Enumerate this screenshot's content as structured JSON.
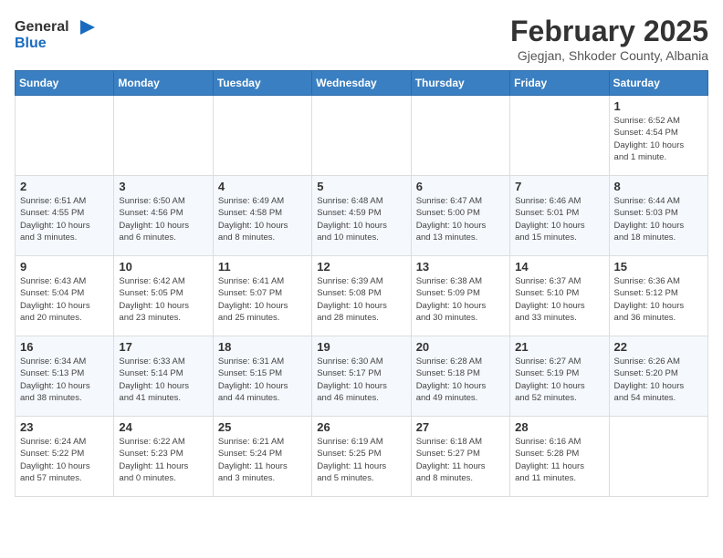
{
  "header": {
    "logo_general": "General",
    "logo_blue": "Blue",
    "title": "February 2025",
    "subtitle": "Gjegjan, Shkoder County, Albania"
  },
  "weekdays": [
    "Sunday",
    "Monday",
    "Tuesday",
    "Wednesday",
    "Thursday",
    "Friday",
    "Saturday"
  ],
  "weeks": [
    [
      {
        "day": "",
        "info": ""
      },
      {
        "day": "",
        "info": ""
      },
      {
        "day": "",
        "info": ""
      },
      {
        "day": "",
        "info": ""
      },
      {
        "day": "",
        "info": ""
      },
      {
        "day": "",
        "info": ""
      },
      {
        "day": "1",
        "info": "Sunrise: 6:52 AM\nSunset: 4:54 PM\nDaylight: 10 hours\nand 1 minute."
      }
    ],
    [
      {
        "day": "2",
        "info": "Sunrise: 6:51 AM\nSunset: 4:55 PM\nDaylight: 10 hours\nand 3 minutes."
      },
      {
        "day": "3",
        "info": "Sunrise: 6:50 AM\nSunset: 4:56 PM\nDaylight: 10 hours\nand 6 minutes."
      },
      {
        "day": "4",
        "info": "Sunrise: 6:49 AM\nSunset: 4:58 PM\nDaylight: 10 hours\nand 8 minutes."
      },
      {
        "day": "5",
        "info": "Sunrise: 6:48 AM\nSunset: 4:59 PM\nDaylight: 10 hours\nand 10 minutes."
      },
      {
        "day": "6",
        "info": "Sunrise: 6:47 AM\nSunset: 5:00 PM\nDaylight: 10 hours\nand 13 minutes."
      },
      {
        "day": "7",
        "info": "Sunrise: 6:46 AM\nSunset: 5:01 PM\nDaylight: 10 hours\nand 15 minutes."
      },
      {
        "day": "8",
        "info": "Sunrise: 6:44 AM\nSunset: 5:03 PM\nDaylight: 10 hours\nand 18 minutes."
      }
    ],
    [
      {
        "day": "9",
        "info": "Sunrise: 6:43 AM\nSunset: 5:04 PM\nDaylight: 10 hours\nand 20 minutes."
      },
      {
        "day": "10",
        "info": "Sunrise: 6:42 AM\nSunset: 5:05 PM\nDaylight: 10 hours\nand 23 minutes."
      },
      {
        "day": "11",
        "info": "Sunrise: 6:41 AM\nSunset: 5:07 PM\nDaylight: 10 hours\nand 25 minutes."
      },
      {
        "day": "12",
        "info": "Sunrise: 6:39 AM\nSunset: 5:08 PM\nDaylight: 10 hours\nand 28 minutes."
      },
      {
        "day": "13",
        "info": "Sunrise: 6:38 AM\nSunset: 5:09 PM\nDaylight: 10 hours\nand 30 minutes."
      },
      {
        "day": "14",
        "info": "Sunrise: 6:37 AM\nSunset: 5:10 PM\nDaylight: 10 hours\nand 33 minutes."
      },
      {
        "day": "15",
        "info": "Sunrise: 6:36 AM\nSunset: 5:12 PM\nDaylight: 10 hours\nand 36 minutes."
      }
    ],
    [
      {
        "day": "16",
        "info": "Sunrise: 6:34 AM\nSunset: 5:13 PM\nDaylight: 10 hours\nand 38 minutes."
      },
      {
        "day": "17",
        "info": "Sunrise: 6:33 AM\nSunset: 5:14 PM\nDaylight: 10 hours\nand 41 minutes."
      },
      {
        "day": "18",
        "info": "Sunrise: 6:31 AM\nSunset: 5:15 PM\nDaylight: 10 hours\nand 44 minutes."
      },
      {
        "day": "19",
        "info": "Sunrise: 6:30 AM\nSunset: 5:17 PM\nDaylight: 10 hours\nand 46 minutes."
      },
      {
        "day": "20",
        "info": "Sunrise: 6:28 AM\nSunset: 5:18 PM\nDaylight: 10 hours\nand 49 minutes."
      },
      {
        "day": "21",
        "info": "Sunrise: 6:27 AM\nSunset: 5:19 PM\nDaylight: 10 hours\nand 52 minutes."
      },
      {
        "day": "22",
        "info": "Sunrise: 6:26 AM\nSunset: 5:20 PM\nDaylight: 10 hours\nand 54 minutes."
      }
    ],
    [
      {
        "day": "23",
        "info": "Sunrise: 6:24 AM\nSunset: 5:22 PM\nDaylight: 10 hours\nand 57 minutes."
      },
      {
        "day": "24",
        "info": "Sunrise: 6:22 AM\nSunset: 5:23 PM\nDaylight: 11 hours\nand 0 minutes."
      },
      {
        "day": "25",
        "info": "Sunrise: 6:21 AM\nSunset: 5:24 PM\nDaylight: 11 hours\nand 3 minutes."
      },
      {
        "day": "26",
        "info": "Sunrise: 6:19 AM\nSunset: 5:25 PM\nDaylight: 11 hours\nand 5 minutes."
      },
      {
        "day": "27",
        "info": "Sunrise: 6:18 AM\nSunset: 5:27 PM\nDaylight: 11 hours\nand 8 minutes."
      },
      {
        "day": "28",
        "info": "Sunrise: 6:16 AM\nSunset: 5:28 PM\nDaylight: 11 hours\nand 11 minutes."
      },
      {
        "day": "",
        "info": ""
      }
    ]
  ]
}
